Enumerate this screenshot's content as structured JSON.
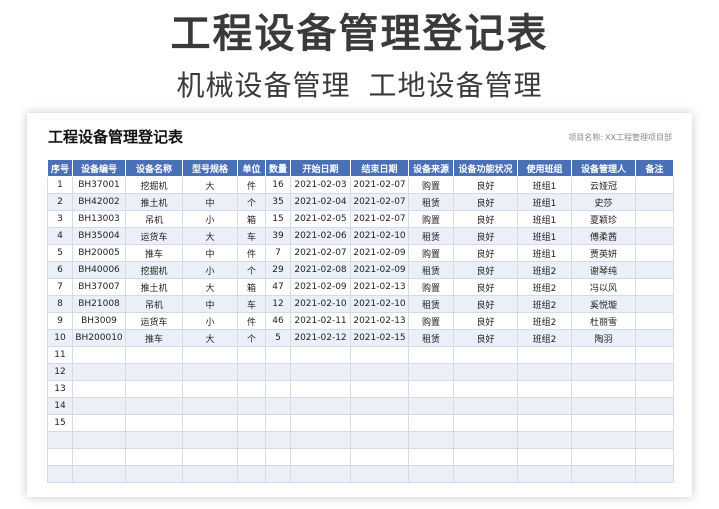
{
  "banner": {
    "title": "工程设备管理登记表",
    "subtitle_1": "机械设备管理",
    "subtitle_2": "工地设备管理"
  },
  "sheet": {
    "title": "工程设备管理登记表",
    "project_label": "项目名称:",
    "project_value": "XX工程管理项目部"
  },
  "table": {
    "columns": [
      "序号",
      "设备编号",
      "设备名称",
      "型号规格",
      "单位",
      "数量",
      "开始日期",
      "结束日期",
      "设备来源",
      "设备功能状况",
      "使用班组",
      "设备管理人",
      "备注"
    ],
    "rows": [
      [
        "1",
        "BH37001",
        "挖掘机",
        "大",
        "件",
        "16",
        "2021-02-03",
        "2021-02-07",
        "购置",
        "良好",
        "班组1",
        "云娅冠",
        ""
      ],
      [
        "2",
        "BH42002",
        "推土机",
        "中",
        "个",
        "35",
        "2021-02-04",
        "2021-02-07",
        "租赁",
        "良好",
        "班组1",
        "史莎",
        ""
      ],
      [
        "3",
        "BH13003",
        "吊机",
        "小",
        "箱",
        "15",
        "2021-02-05",
        "2021-02-07",
        "购置",
        "良好",
        "班组1",
        "夏颖珍",
        ""
      ],
      [
        "4",
        "BH35004",
        "运货车",
        "大",
        "车",
        "39",
        "2021-02-06",
        "2021-02-10",
        "租赁",
        "良好",
        "班组1",
        "傅柔茜",
        ""
      ],
      [
        "5",
        "BH20005",
        "推车",
        "中",
        "件",
        "7",
        "2021-02-07",
        "2021-02-09",
        "购置",
        "良好",
        "班组1",
        "贾英妍",
        ""
      ],
      [
        "6",
        "BH40006",
        "挖掘机",
        "小",
        "个",
        "29",
        "2021-02-08",
        "2021-02-09",
        "租赁",
        "良好",
        "班组2",
        "谢琴纯",
        ""
      ],
      [
        "7",
        "BH37007",
        "推土机",
        "大",
        "箱",
        "47",
        "2021-02-09",
        "2021-02-13",
        "购置",
        "良好",
        "班组2",
        "冯以风",
        ""
      ],
      [
        "8",
        "BH21008",
        "吊机",
        "中",
        "车",
        "12",
        "2021-02-10",
        "2021-02-10",
        "租赁",
        "良好",
        "班组2",
        "奚悦璇",
        ""
      ],
      [
        "9",
        "BH3009",
        "运货车",
        "小",
        "件",
        "46",
        "2021-02-11",
        "2021-02-13",
        "购置",
        "良好",
        "班组2",
        "杜丽雪",
        ""
      ],
      [
        "10",
        "BH200010",
        "推车",
        "大",
        "个",
        "5",
        "2021-02-12",
        "2021-02-15",
        "租赁",
        "良好",
        "班组2",
        "陶羽",
        ""
      ],
      [
        "11",
        "",
        "",
        "",
        "",
        "",
        "",
        "",
        "",
        "",
        "",
        "",
        ""
      ],
      [
        "12",
        "",
        "",
        "",
        "",
        "",
        "",
        "",
        "",
        "",
        "",
        "",
        ""
      ],
      [
        "13",
        "",
        "",
        "",
        "",
        "",
        "",
        "",
        "",
        "",
        "",
        "",
        ""
      ],
      [
        "14",
        "",
        "",
        "",
        "",
        "",
        "",
        "",
        "",
        "",
        "",
        "",
        ""
      ],
      [
        "15",
        "",
        "",
        "",
        "",
        "",
        "",
        "",
        "",
        "",
        "",
        "",
        ""
      ],
      [
        "",
        "",
        "",
        "",
        "",
        "",
        "",
        "",
        "",
        "",
        "",
        "",
        ""
      ],
      [
        "",
        "",
        "",
        "",
        "",
        "",
        "",
        "",
        "",
        "",
        "",
        "",
        ""
      ],
      [
        "",
        "",
        "",
        "",
        "",
        "",
        "",
        "",
        "",
        "",
        "",
        "",
        ""
      ]
    ]
  },
  "colors": {
    "header_bg": "#4a70b8",
    "stripe_bg": "#eaeff8"
  }
}
